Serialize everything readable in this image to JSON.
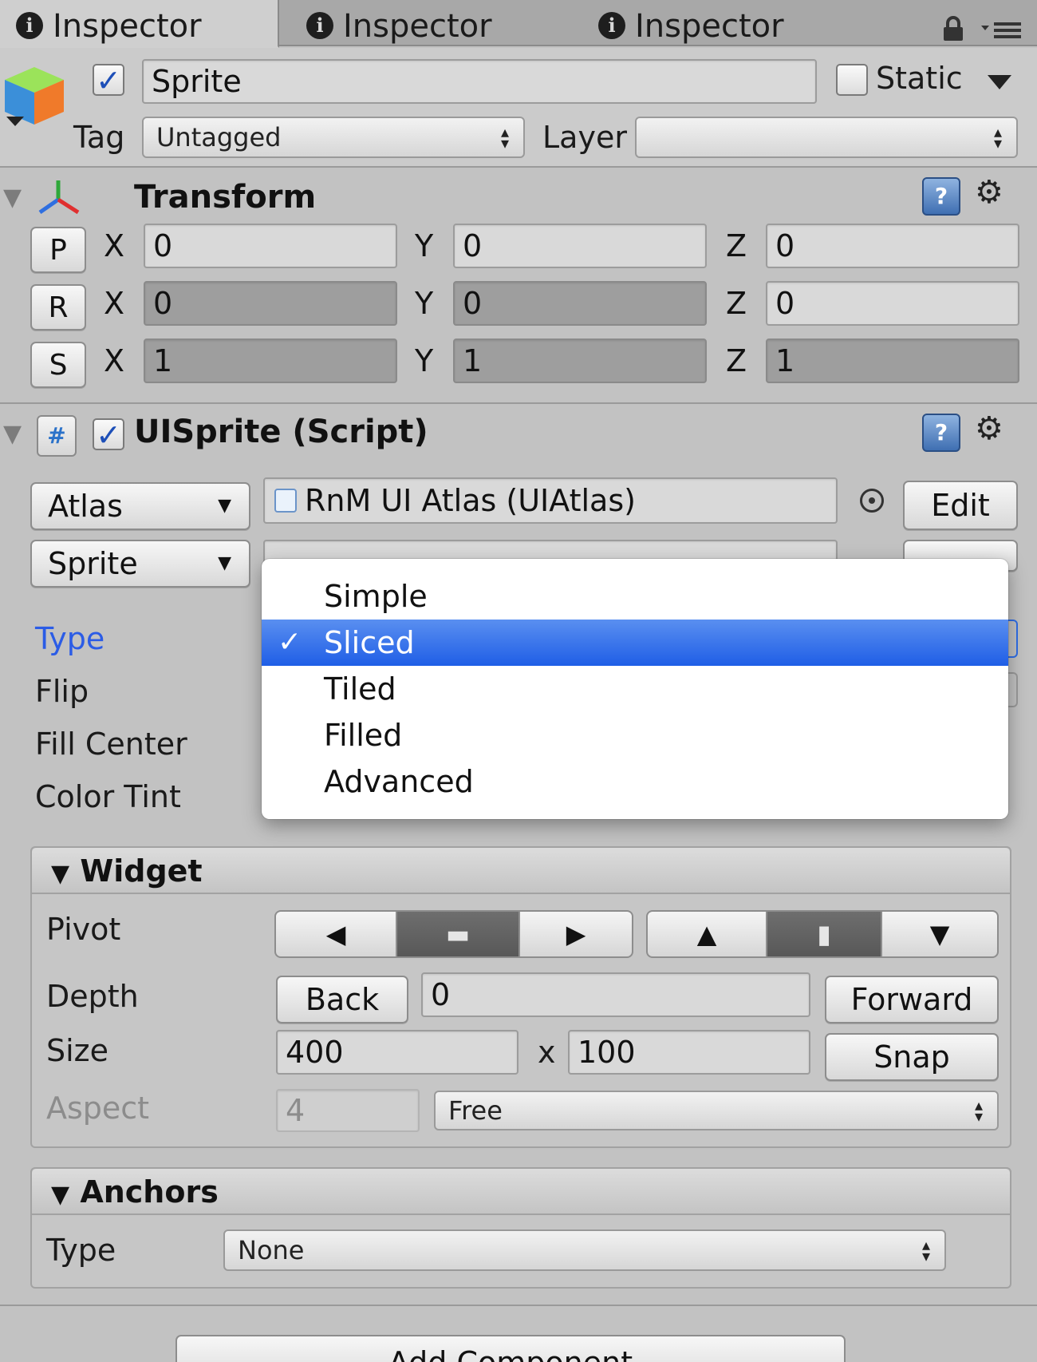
{
  "tabs": [
    {
      "label": "Inspector",
      "active": true
    },
    {
      "label": "Inspector",
      "active": false
    },
    {
      "label": "Inspector",
      "active": false
    }
  ],
  "gameobject": {
    "enabled": true,
    "name": "Sprite",
    "static_label": "Static",
    "static_checked": false,
    "tag_label": "Tag",
    "tag_value": "Untagged",
    "layer_label": "Layer",
    "layer_value": ""
  },
  "transform": {
    "title": "Transform",
    "rows": [
      {
        "button": "P",
        "x": "0",
        "y": "0",
        "z": "0"
      },
      {
        "button": "R",
        "x": "0",
        "y": "0",
        "z": "0"
      },
      {
        "button": "S",
        "x": "1",
        "y": "1",
        "z": "1"
      }
    ],
    "axis_x": "X",
    "axis_y": "Y",
    "axis_z": "Z"
  },
  "uisprite": {
    "title": "UISprite (Script)",
    "enabled": true,
    "atlas_label": "Atlas",
    "atlas_value": "RnM UI Atlas (UIAtlas)",
    "sprite_label": "Sprite",
    "edit_label": "Edit",
    "props": [
      "Type",
      "Flip",
      "Fill Center",
      "Color Tint"
    ]
  },
  "type_menu": {
    "options": [
      "Simple",
      "Sliced",
      "Tiled",
      "Filled",
      "Advanced"
    ],
    "selected": "Sliced",
    "check_mark": "✓"
  },
  "widget": {
    "title": "Widget",
    "pivot_label": "Pivot",
    "depth_label": "Depth",
    "back_label": "Back",
    "depth_value": "0",
    "forward_label": "Forward",
    "size_label": "Size",
    "width": "400",
    "times": "x",
    "height": "100",
    "snap_label": "Snap",
    "aspect_label": "Aspect",
    "aspect_value": "4",
    "aspect_mode": "Free"
  },
  "anchors": {
    "title": "Anchors",
    "type_label": "Type",
    "type_value": "None"
  },
  "add_component_label": "Add Component",
  "colors": {
    "accent_blue": "#1f5ee6",
    "type_label_blue": "#2b5ce6"
  }
}
